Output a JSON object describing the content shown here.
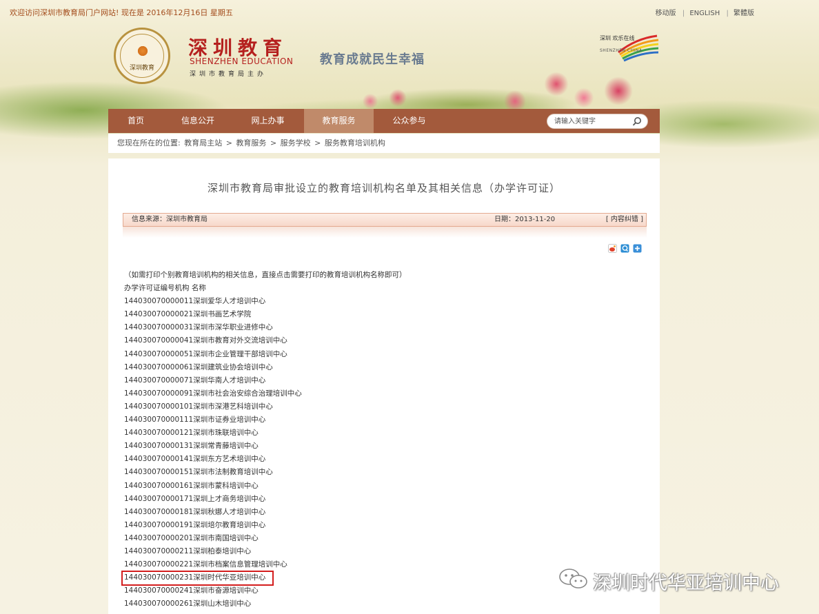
{
  "topbar": {
    "welcome": "欢迎访问深圳市教育局门户网站! 现在是 2016年12月16日 星期五",
    "links": [
      "移动版",
      "ENGLISH",
      "繁體版"
    ]
  },
  "header": {
    "seal_text": "深圳教育",
    "brand_cn": "深圳教育",
    "brand_en": "SHENZHEN EDUCATION",
    "brand_sub": "深圳市教育局主办",
    "slogan": "教育成就民生幸福",
    "china_script": "深圳 欢乐在线",
    "china_text": "SHENZHEN CHINA"
  },
  "nav": {
    "items": [
      {
        "label": "首页"
      },
      {
        "label": "信息公开"
      },
      {
        "label": "网上办事"
      },
      {
        "label": "教育服务"
      },
      {
        "label": "公众参与"
      }
    ],
    "active_index": 3,
    "search_placeholder": "请输入关键字"
  },
  "breadcrumb": {
    "prefix": "您现在所在的位置:",
    "items": [
      "教育局主站",
      "教育服务",
      "服务学校",
      "服务教育培训机构"
    ],
    "separator": ">"
  },
  "article": {
    "title": "深圳市教育局审批设立的教育培训机构名单及其相关信息（办学许可证）",
    "source": "信息来源：深圳市教育局",
    "date": "日期：2013-11-20",
    "correct": "[ 内容纠错 ]",
    "note": "（如需打印个别教育培训机构的相关信息，直接点击需要打印的教育培训机构名称即可）",
    "header_line": "办学许可证编号机构 名称",
    "entries": [
      "144030070000011深圳爱华人才培训中心",
      "144030070000021深圳书画艺术学院",
      "144030070000031深圳市深华职业进修中心",
      "144030070000041深圳市教育对外交流培训中心",
      "144030070000051深圳市企业管理干部培训中心",
      "144030070000061深圳建筑业协会培训中心",
      "144030070000071深圳华南人才培训中心",
      "144030070000091深圳市社会治安综合治理培训中心",
      "144030070000101深圳市深港艺科培训中心",
      "144030070000111深圳市证券业培训中心",
      "144030070000121深圳市珠联培训中心",
      "144030070000131深圳常青藤培训中心",
      "144030070000141深圳东方艺术培训中心",
      "144030070000151深圳市法制教育培训中心",
      "144030070000161深圳市蒙科培训中心",
      "144030070000171深圳上才商务培训中心",
      "144030070000181深圳秋娜人才培训中心",
      "144030070000191深圳培尔教育培训中心",
      "144030070000201深圳市南国培训中心",
      "144030070000211深圳柏泰培训中心",
      "144030070000221深圳市档案信息管理培训中心",
      "144030070000231深圳时代华亚培训中心",
      "144030070000241深圳市奋源培训中心",
      "144030070000261深圳山木培训中心"
    ],
    "highlighted_index": 21
  },
  "watermark": {
    "text": "深圳时代华亚培训中心",
    "icon": "wechat-icon"
  },
  "colors": {
    "nav_bg": "#a35a3c",
    "nav_active": "#c08a6a",
    "brand_red": "#b5201e",
    "highlight_box": "#d31d1d"
  }
}
